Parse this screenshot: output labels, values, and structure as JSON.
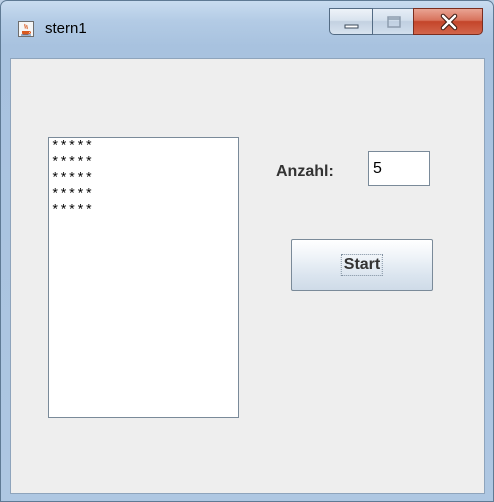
{
  "window": {
    "title": "stern1",
    "icon": "java-cup-icon",
    "caption_buttons": [
      "minimize-icon",
      "maximize-icon",
      "close-icon"
    ]
  },
  "output": {
    "lines": [
      "*****",
      "*****",
      "*****",
      "*****",
      "*****"
    ]
  },
  "form": {
    "anzahl_label": "Anzahl:",
    "anzahl_value": "5",
    "start_label": "Start"
  },
  "colors": {
    "client_bg": "#eeeeee",
    "close_button": "#c4452a"
  }
}
